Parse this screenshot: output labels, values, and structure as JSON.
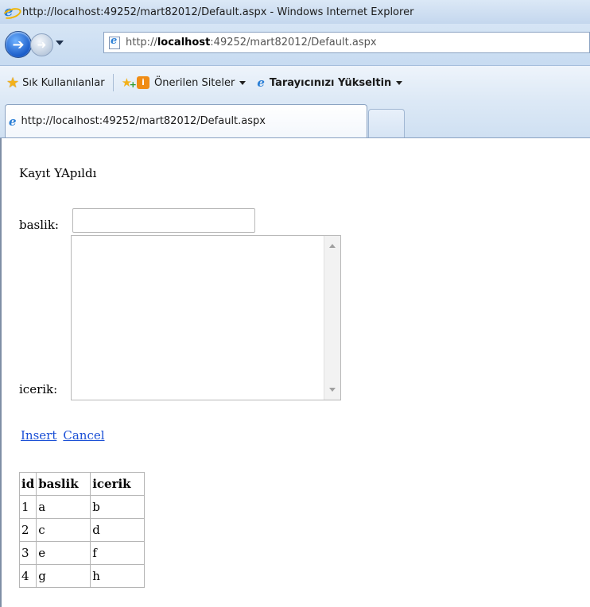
{
  "window": {
    "title": "http://localhost:49252/mart82012/Default.aspx - Windows Internet Explorer"
  },
  "addressbar": {
    "prefix": "http://",
    "host": "localhost",
    "rest": ":49252/mart82012/Default.aspx"
  },
  "favorites": {
    "favorites_label": "Sık Kullanılanlar",
    "suggested_label": "Önerilen Siteler",
    "upgrade_label": "Tarayıcınızı Yükseltin"
  },
  "tabs": {
    "active_label": "http://localhost:49252/mart82012/Default.aspx"
  },
  "page": {
    "message": "Kayıt YApıldı",
    "baslik_label": "baslik:",
    "baslik_value": "",
    "icerik_label": "icerik:",
    "icerik_value": "",
    "insert_link": "Insert",
    "cancel_link": "Cancel",
    "table": {
      "headers": [
        "id",
        "baslik",
        "icerik"
      ],
      "rows": [
        [
          "1",
          "a",
          "b"
        ],
        [
          "2",
          "c",
          "d"
        ],
        [
          "3",
          "e",
          "f"
        ],
        [
          "4",
          "g",
          "h"
        ]
      ]
    }
  }
}
